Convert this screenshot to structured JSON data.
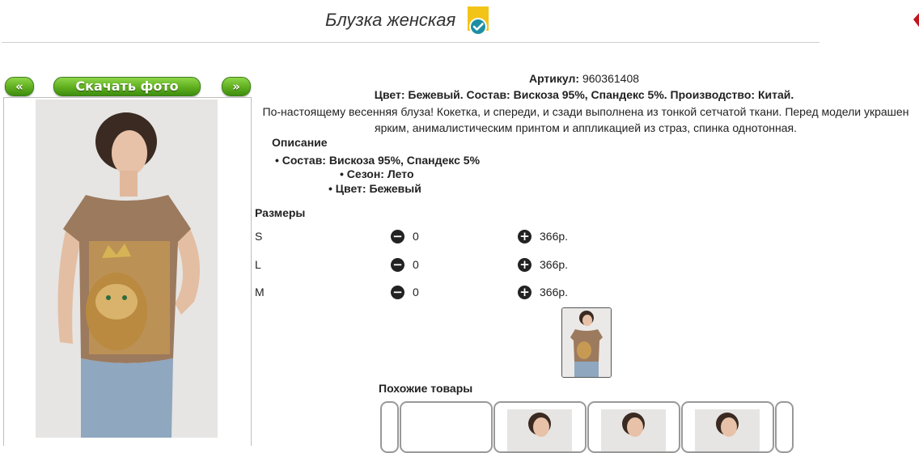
{
  "header": {
    "title": "Блузка женская",
    "badge_icon": "verified-check-icon",
    "badge_color": "#f2c418",
    "check_color": "#1e8fa3"
  },
  "gallery": {
    "prev_label": "«",
    "next_label": "»",
    "download_label": "Скачать фото",
    "button_color": "#5fae1e"
  },
  "product": {
    "article_label": "Артикул:",
    "article_value": "960361408",
    "spec_line": "Цвет: Бежевый. Состав: Вискоза 95%, Спандекс 5%. Производство: Китай.",
    "description": "По-настоящему весенняя блуза! Кокетка, и спереди, и сзади выполнена из тонкой сетчатой ткани. Перед модели украшен ярким, анималистическим принтом и аппликацией из страз, спинка однотонная.",
    "description_heading": "Описание",
    "bullets": [
      "Состав: Вискоза 95%, Спандекс 5%",
      "Сезон: Лето",
      "Цвет: Бежевый"
    ]
  },
  "sizes": {
    "heading": "Размеры",
    "rows": [
      {
        "size": "S",
        "qty": "0",
        "price": "366р."
      },
      {
        "size": "L",
        "qty": "0",
        "price": "366р."
      },
      {
        "size": "M",
        "qty": "0",
        "price": "366р."
      }
    ],
    "minus_icon": "minus-circle-icon",
    "plus_icon": "plus-circle-icon"
  },
  "similar": {
    "heading": "Похожие товары"
  }
}
